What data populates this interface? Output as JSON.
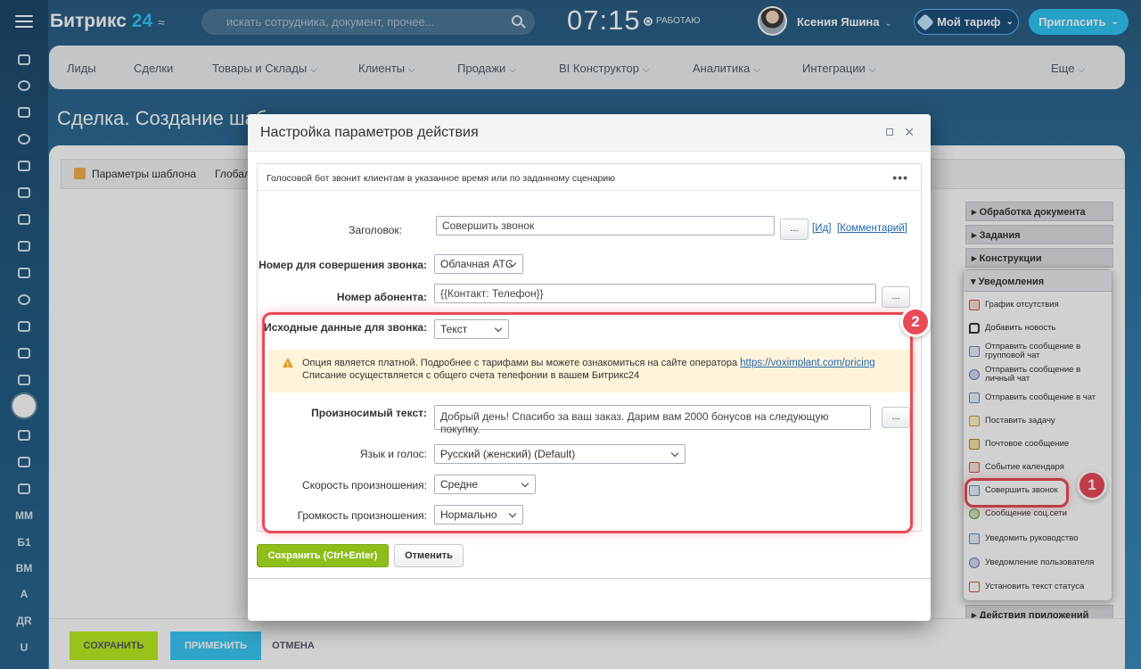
{
  "sidebar": {
    "items": [
      {
        "name": "home-icon"
      },
      {
        "name": "target-icon"
      },
      {
        "name": "cart-icon"
      },
      {
        "name": "sites-icon"
      },
      {
        "name": "crm-icon"
      },
      {
        "name": "chat-icon"
      },
      {
        "name": "calendar-icon"
      },
      {
        "name": "doc-icon"
      },
      {
        "name": "drive-icon"
      },
      {
        "name": "group-icon"
      },
      {
        "name": "contacts-icon"
      },
      {
        "name": "filter-icon"
      },
      {
        "name": "stream-icon"
      },
      {
        "name": "bot-icon"
      },
      {
        "name": "box-icon"
      },
      {
        "name": "mixed-icon"
      },
      {
        "name": "code-icon"
      }
    ],
    "text_items": [
      "MM",
      "Б1",
      "ВМ",
      "A",
      "ДR",
      "U"
    ]
  },
  "header": {
    "logo_brand": "Битрикс",
    "logo_num": "24",
    "search_placeholder": "искать сотрудника, документ, прочее...",
    "clock": "07:15",
    "work_status": "РАБОТАЮ",
    "user_name": "Ксения Яшина",
    "tariff_label": "Мой тариф",
    "invite_label": "Пригласить"
  },
  "nav": {
    "items": [
      "Лиды",
      "Сделки",
      "Товары и Склады",
      "Клиенты",
      "Продажи",
      "BI Конструктор",
      "Аналитика",
      "Интеграции",
      "Еще"
    ]
  },
  "page": {
    "title": "Сделка. Создание шаблона",
    "template_tab": "Параметры шаблона",
    "global_tab": "Глобальные"
  },
  "right_panel": {
    "sections": [
      "Обработка документа",
      "Задания",
      "Конструкции",
      "Уведомления",
      "Действия приложений"
    ],
    "items": [
      "График отсутствия",
      "Добавить новость",
      "Отправить сообщение в групповой чат",
      "Отправить сообщение в личный чат",
      "Отправить сообщение в чат",
      "Поставить задачу",
      "Почтовое сообщение",
      "Событие календаря",
      "Совершить звонок",
      "Сообщение соц.сети",
      "Уведомить руководство",
      "Уведомление пользователя",
      "Установить текст статуса"
    ]
  },
  "annotations": {
    "badge1": "1",
    "badge2": "2",
    "accent": "#e94a58"
  },
  "dialog": {
    "title": "Настройка параметров действия",
    "description": "Голосовой бот звонит клиентам в указанное время или по заданному сценарию",
    "fields": {
      "title_label": "Заголовок:",
      "title_value": "Совершить звонок",
      "id_link": "Ид",
      "comment_link": "Комментарий",
      "caller_label": "Номер для совершения звонка:",
      "caller_value": "Облачная АТС",
      "subscriber_label": "Номер абонента:",
      "subscriber_value": "{{Контакт: Телефон}}",
      "source_label": "Исходные данные для звонка:",
      "source_value": "Текст",
      "warning_line1": "Опция является платной. Подробнее с тарифами вы можете ознакомиться на сайте оператора",
      "warning_link": "https://voximplant.com/pricing",
      "warning_line2": "Списание осуществляется с общего счета телефонии в вашем Битрикс24",
      "speech_label": "Произносимый текст:",
      "speech_value": "Добрый день! Спасибо за ваш заказ. Дарим вам 2000 бонусов на следующую покупку.",
      "voice_label": "Язык и голос:",
      "voice_value": "Русский (женский) (Default)",
      "speed_label": "Скорость произношения:",
      "speed_value": "Средне",
      "volume_label": "Громкость произношения:",
      "volume_value": "Нормально",
      "dots": "..."
    },
    "save_label": "Сохранить (Ctrl+Enter)",
    "cancel_label": "Отменить"
  },
  "bottom": {
    "save": "СОХРАНИТЬ",
    "apply": "ПРИМЕНИТЬ",
    "cancel": "ОТМЕНА"
  },
  "colors": {
    "brand_blue": "#2fc6f6",
    "save_green": "#8fbe1b",
    "bottom_save": "#bbed21",
    "bottom_apply": "#3bc8f5",
    "highlight": "#e94a58"
  }
}
